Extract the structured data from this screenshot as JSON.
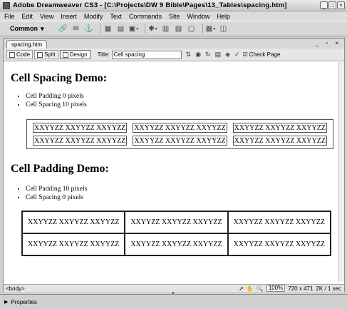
{
  "window": {
    "title": "Adobe Dreamweaver CS3 - [C:\\Projects\\DW 9 Bible\\Pages\\13_Tables\\spacing.htm]",
    "buttons": [
      "_",
      "□",
      "×"
    ]
  },
  "menu": {
    "items": [
      "File",
      "Edit",
      "View",
      "Insert",
      "Modify",
      "Text",
      "Commands",
      "Site",
      "Window",
      "Help"
    ]
  },
  "insert_bar": {
    "category": "Common"
  },
  "document": {
    "tab_label": "spacing.htm",
    "window_controls": "_ ▫ ×",
    "view_buttons": {
      "code": "Code",
      "split": "Split",
      "design": "Design"
    },
    "title_label": "Title:",
    "title_value": "Cell spacing",
    "check_page": "Check Page"
  },
  "page": {
    "heading1": "Cell Spacing Demo:",
    "list1": [
      "Cell Padding 0 pixels",
      "Cell Spacing 10 pixels"
    ],
    "heading2": "Cell Padding Demo:",
    "list2": [
      "Cell Padding 10 pixels",
      "Cell Spacing 0 pixels"
    ],
    "table1": [
      [
        "XXYYZZ XXYYZZ XXYYZZ",
        "XXYYZZ XXYYZZ XXYYZZ",
        "XXYYZZ XXYYZZ XXYYZZ"
      ],
      [
        "XXYYZZ XXYYZZ XXYYZZ",
        "XXYYZZ XXYYZZ XXYYZZ",
        "XXYYZZ XXYYZZ XXYYZZ"
      ]
    ],
    "table2": [
      [
        "XXYYZZ XXYYZZ XXYYZZ",
        "XXYYZZ XXYYZZ XXYYZZ",
        "XXYYZZ XXYYZZ XXYYZZ"
      ],
      [
        "XXYYZZ XXYYZZ XXYYZZ",
        "XXYYZZ XXYYZZ XXYYZZ",
        "XXYYZZ XXYYZZ XXYYZZ"
      ]
    ]
  },
  "status": {
    "tag": "<body>",
    "zoom": "100%",
    "window_size": "720 x 471",
    "download": "2K / 1 sec"
  },
  "properties": {
    "label": "Properties"
  }
}
